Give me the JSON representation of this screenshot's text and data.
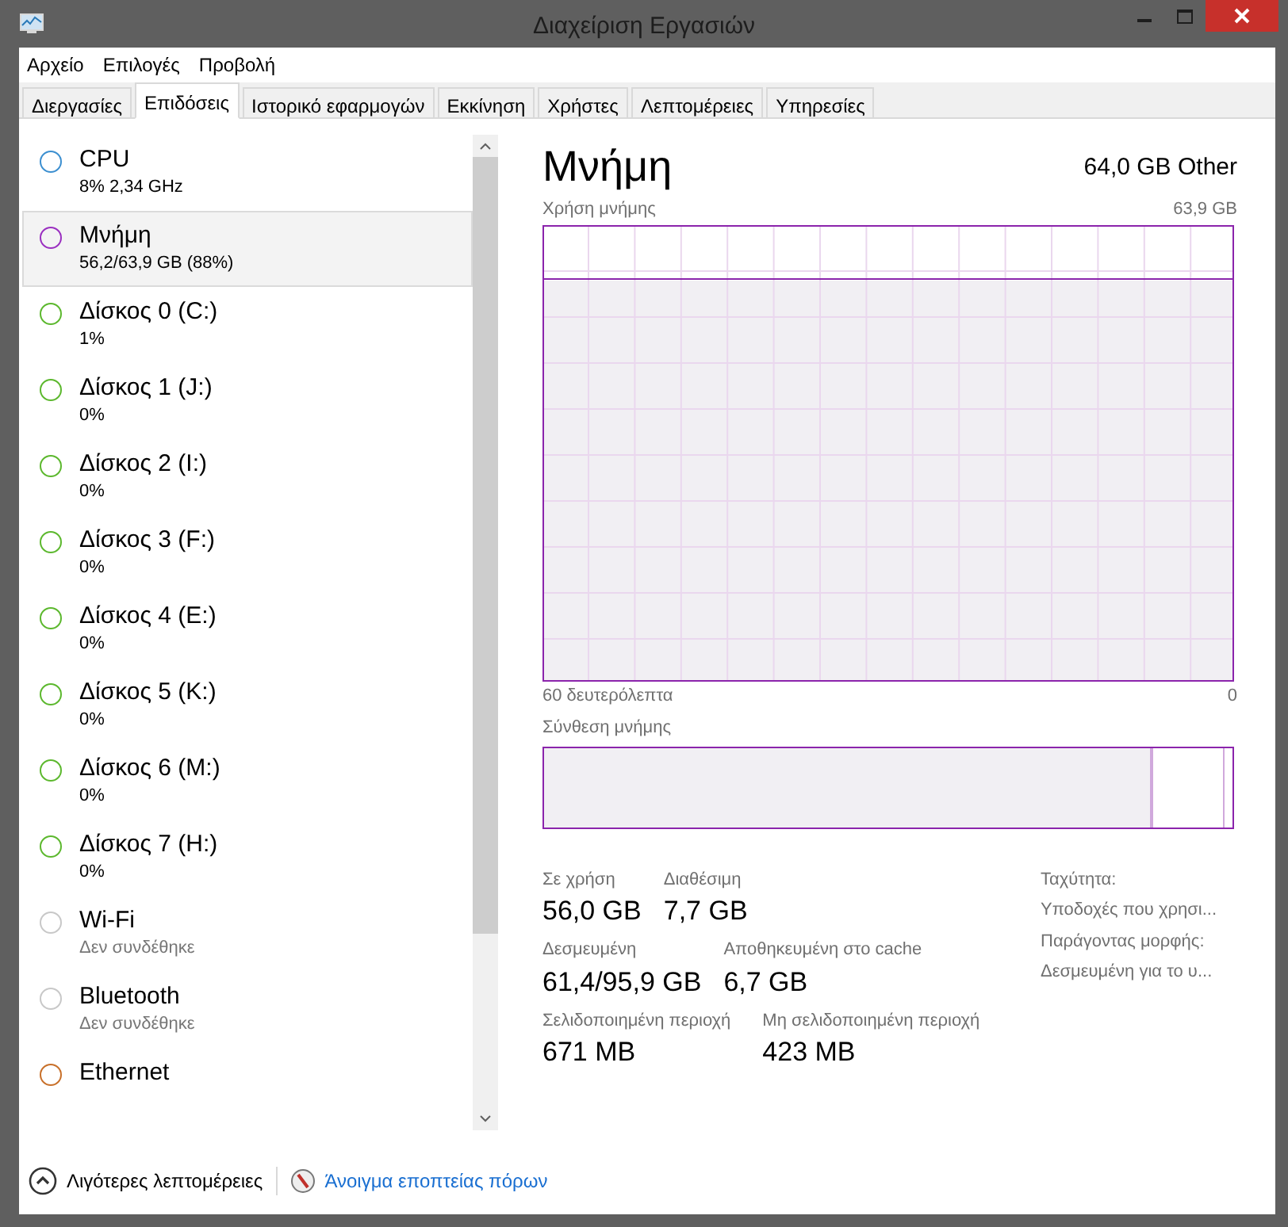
{
  "window": {
    "title": "Διαχείριση Εργασιών"
  },
  "menu": [
    "Αρχείο",
    "Επιλογές",
    "Προβολή"
  ],
  "tabs": [
    {
      "label": "Διεργασίες",
      "selected": false
    },
    {
      "label": "Επιδόσεις",
      "selected": true
    },
    {
      "label": "Ιστορικό εφαρμογών",
      "selected": false
    },
    {
      "label": "Εκκίνηση",
      "selected": false
    },
    {
      "label": "Χρήστες",
      "selected": false
    },
    {
      "label": "Λεπτομέρειες",
      "selected": false
    },
    {
      "label": "Υπηρεσίες",
      "selected": false
    }
  ],
  "sidebar": {
    "items": [
      {
        "name": "CPU",
        "detail": "8%  2,34 GHz",
        "color": "#3c8fd0",
        "selected": false
      },
      {
        "name": "Μνήμη",
        "detail": "56,2/63,9 GB (88%)",
        "color": "#9a2fc0",
        "selected": true
      },
      {
        "name": "Δίσκος 0 (C:)",
        "detail": "1%",
        "color": "#5cb82e",
        "selected": false
      },
      {
        "name": "Δίσκος 1 (J:)",
        "detail": "0%",
        "color": "#5cb82e",
        "selected": false
      },
      {
        "name": "Δίσκος 2 (I:)",
        "detail": "0%",
        "color": "#5cb82e",
        "selected": false
      },
      {
        "name": "Δίσκος 3 (F:)",
        "detail": "0%",
        "color": "#5cb82e",
        "selected": false
      },
      {
        "name": "Δίσκος 4 (E:)",
        "detail": "0%",
        "color": "#5cb82e",
        "selected": false
      },
      {
        "name": "Δίσκος 5 (K:)",
        "detail": "0%",
        "color": "#5cb82e",
        "selected": false
      },
      {
        "name": "Δίσκος 6 (M:)",
        "detail": "0%",
        "color": "#5cb82e",
        "selected": false
      },
      {
        "name": "Δίσκος 7 (H:)",
        "detail": "0%",
        "color": "#5cb82e",
        "selected": false
      },
      {
        "name": "Wi-Fi",
        "detail": "Δεν συνδέθηκε",
        "color": "#c8c8c8",
        "selected": false
      },
      {
        "name": "Bluetooth",
        "detail": "Δεν συνδέθηκε",
        "color": "#c8c8c8",
        "selected": false
      },
      {
        "name": "Ethernet",
        "color": "#c8702a",
        "selected": false
      }
    ]
  },
  "panel": {
    "title": "Μνήμη",
    "subtitle": "64,0 GB Other",
    "usage_graph": {
      "label": "Χρήση μνήμης",
      "max": "63,9 GB",
      "x_start": "60 δευτερόλεπτα",
      "x_end": "0"
    },
    "composition": {
      "label": "Σύνθεση μνήμης",
      "level": 0.885
    },
    "stats": [
      [
        {
          "label": "Σε χρήση",
          "value": "56,0 GB"
        },
        {
          "label": "Διαθέσιμη",
          "value": "7,7 GB"
        }
      ],
      [
        {
          "label": "Δεσμευμένη",
          "value": "61,4/95,9 GB"
        },
        {
          "label": "Αποθηκευμένη στο cache",
          "value": "6,7 GB"
        }
      ],
      [
        {
          "label": "Σελιδοποιημένη περιοχή",
          "value": "671 MB"
        },
        {
          "label": "Μη σελιδοποιημένη περιοχή",
          "value": "423 MB"
        }
      ]
    ],
    "properties": [
      "Ταχύτητα:",
      "Υποδοχές που χρησι...",
      "Παράγοντας μορφής:",
      "Δεσμευμένη για το υ..."
    ]
  },
  "footer": {
    "fewer_details": "Λιγότερες λεπτομέρειες",
    "resource_monitor": "Άνοιγμα εποπτείας πόρων"
  }
}
